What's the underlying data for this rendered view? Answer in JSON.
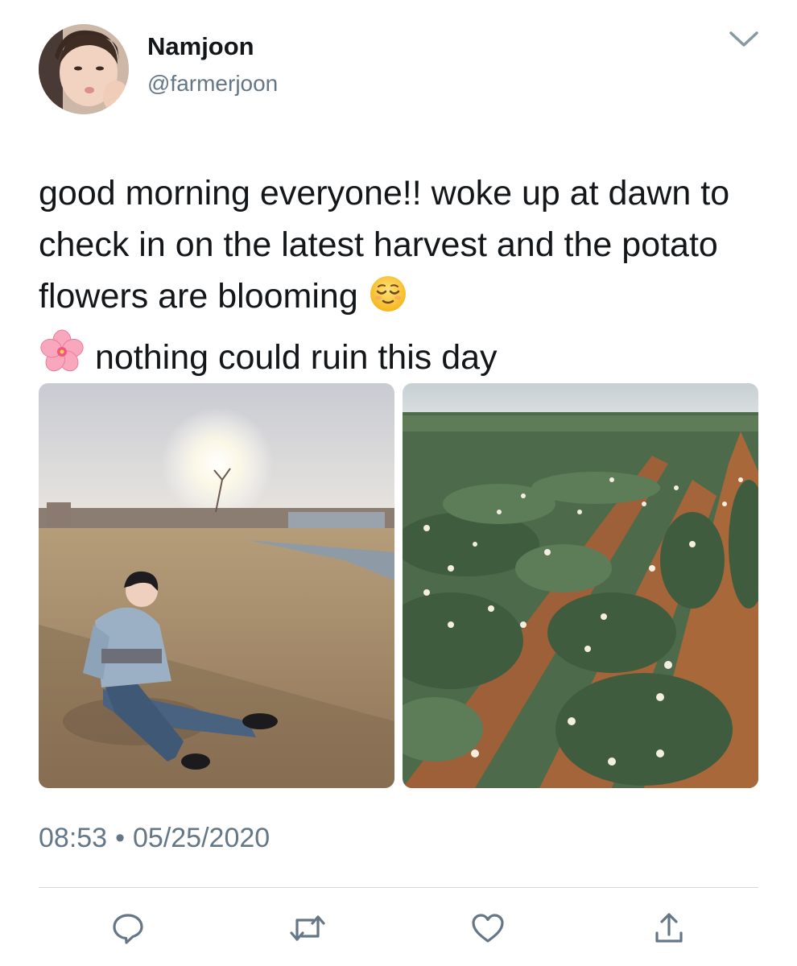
{
  "tweet": {
    "author": {
      "display_name": "Namjoon",
      "handle": "@farmerjoon"
    },
    "text_part1": "good morning everyone!! woke up at dawn to check in on the latest harvest and the potato flowers are blooming",
    "emoji_1": "relieved-face",
    "emoji_2": "cherry-blossom",
    "text_part2": "nothing could ruin this day",
    "time": "08:53",
    "separator": "•",
    "date": "05/25/2020"
  },
  "media": [
    {
      "subject": "person-sitting-on-grass-photo"
    },
    {
      "subject": "potato-field-photo"
    }
  ],
  "actions": [
    {
      "name": "reply",
      "icon": "reply-icon"
    },
    {
      "name": "retweet",
      "icon": "retweet-icon"
    },
    {
      "name": "like",
      "icon": "heart-icon"
    },
    {
      "name": "share",
      "icon": "share-icon"
    }
  ],
  "colors": {
    "text": "#14171a",
    "secondary_text": "#657786",
    "icon": "#657786",
    "divider": "#d4d9de",
    "background": "#ffffff"
  }
}
